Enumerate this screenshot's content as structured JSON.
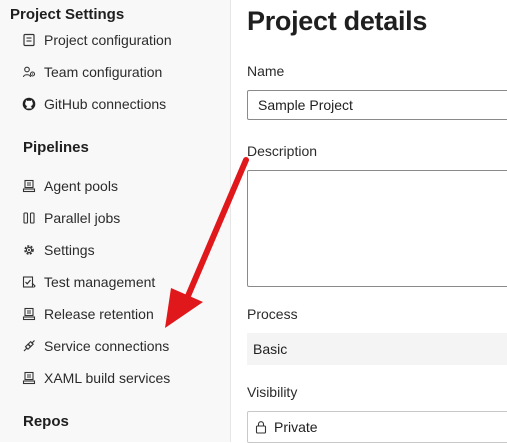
{
  "sidebar": {
    "title": "Project Settings",
    "general_items": [
      {
        "label": "Project configuration",
        "icon": "project-config-icon"
      },
      {
        "label": "Team configuration",
        "icon": "team-config-icon"
      },
      {
        "label": "GitHub connections",
        "icon": "github-icon"
      }
    ],
    "pipelines_heading": "Pipelines",
    "pipelines_items": [
      {
        "label": "Agent pools",
        "icon": "agent-pools-icon"
      },
      {
        "label": "Parallel jobs",
        "icon": "parallel-jobs-icon"
      },
      {
        "label": "Settings",
        "icon": "gear-icon"
      },
      {
        "label": "Test management",
        "icon": "test-management-icon"
      },
      {
        "label": "Release retention",
        "icon": "release-retention-icon"
      },
      {
        "label": "Service connections",
        "icon": "service-connections-icon"
      },
      {
        "label": "XAML build services",
        "icon": "xaml-build-icon"
      }
    ],
    "repos_heading": "Repos"
  },
  "main": {
    "title": "Project details",
    "name_label": "Name",
    "name_value": "Sample Project",
    "description_label": "Description",
    "description_value": "",
    "process_label": "Process",
    "process_value": "Basic",
    "visibility_label": "Visibility",
    "visibility_value": "Private"
  },
  "colors": {
    "annotation_arrow": "#e0181b",
    "sidebar_bg": "#f8f8f8"
  }
}
